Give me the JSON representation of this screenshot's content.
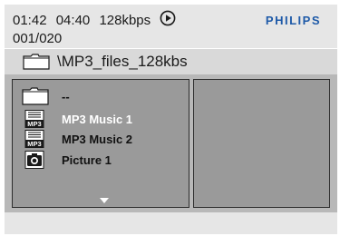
{
  "status": {
    "elapsed": "01:42",
    "total": "04:40",
    "bitrate": "128kbps",
    "play_state_icon": "play-icon",
    "track": "001/020",
    "brand": "PHILIPS"
  },
  "path": {
    "label": "\\MP3_files_128kbs",
    "icon": "folder-icon"
  },
  "file_list": {
    "items": [
      {
        "label": "--",
        "icon": "folder-icon",
        "selected": false
      },
      {
        "label": "MP3 Music 1",
        "icon": "mp3-file-icon",
        "selected": true
      },
      {
        "label": "MP3 Music 2",
        "icon": "mp3-file-icon",
        "selected": false
      },
      {
        "label": "Picture 1",
        "icon": "camera-icon",
        "selected": false
      }
    ],
    "scroll_icon": "scroll-down-arrow-icon"
  },
  "colors": {
    "panel": "#9a9a9a",
    "panel_area": "#b8b8b8",
    "status_bg": "#e6e6e6",
    "brand": "#1e5aa8",
    "selected_text": "#ffffff"
  }
}
